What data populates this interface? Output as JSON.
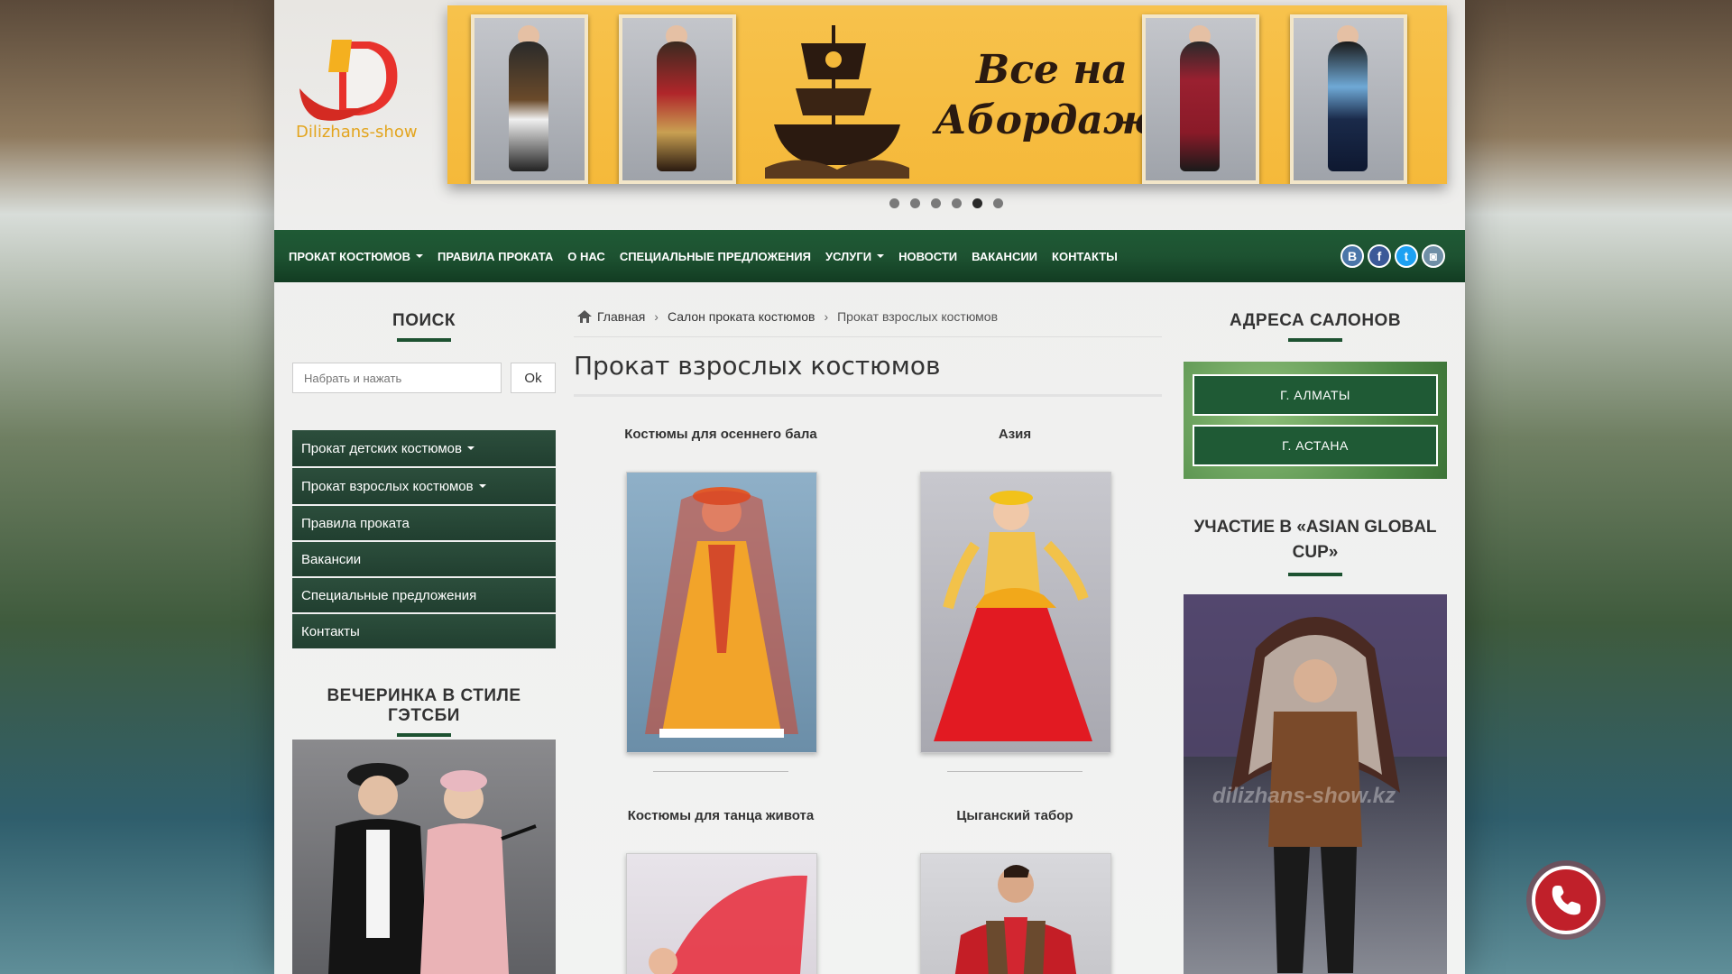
{
  "logo": {
    "text": "Dilizhans-show"
  },
  "banner": {
    "text": "Все на Абордаж!",
    "slides": 6,
    "active_slide": 5
  },
  "nav": {
    "items": [
      {
        "label": "ПРОКАТ КОСТЮМОВ",
        "dropdown": true
      },
      {
        "label": "ПРАВИЛА ПРОКАТА",
        "dropdown": false
      },
      {
        "label": "О НАС",
        "dropdown": false
      },
      {
        "label": "СПЕЦИАЛЬНЫЕ ПРЕДЛОЖЕНИЯ",
        "dropdown": false
      },
      {
        "label": "УСЛУГИ",
        "dropdown": true
      },
      {
        "label": "НОВОСТИ",
        "dropdown": false
      },
      {
        "label": "ВАКАНСИИ",
        "dropdown": false
      },
      {
        "label": "КОНТАКТЫ",
        "dropdown": false
      }
    ],
    "social": [
      {
        "label": "B",
        "icon": "vk-icon",
        "color": "#4a76a8"
      },
      {
        "label": "f",
        "icon": "facebook-icon",
        "color": "#3b5998"
      },
      {
        "label": "t",
        "icon": "twitter-icon",
        "color": "#1da1f2"
      },
      {
        "label": "◙",
        "icon": "instagram-icon",
        "color": "#6f8fa6"
      }
    ]
  },
  "search": {
    "title": "ПОИСК",
    "placeholder": "Набрать и нажать",
    "button": "Ok"
  },
  "side_menu": [
    {
      "label": "Прокат детских костюмов",
      "dropdown": true
    },
    {
      "label": "Прокат взрослых костюмов",
      "dropdown": true
    },
    {
      "label": "Правила проката",
      "dropdown": false
    },
    {
      "label": "Вакансии",
      "dropdown": false
    },
    {
      "label": "Специальные предложения",
      "dropdown": false
    },
    {
      "label": "Контакты",
      "dropdown": false
    }
  ],
  "gatsby": {
    "title": "ВЕЧЕРИНКА В СТИЛЕ ГЭТСБИ"
  },
  "breadcrumb": {
    "home": "Главная",
    "salon": "Салон проката костюмов",
    "current": "Прокат взрослых костюмов"
  },
  "page_title": "Прокат взрослых костюмов",
  "cards": [
    {
      "title": "Костюмы для осеннего бала"
    },
    {
      "title": "Азия"
    },
    {
      "title": "Костюмы для танца живота"
    },
    {
      "title": "Цыганский табор"
    }
  ],
  "addresses": {
    "title": "АДРЕСА САЛОНОВ",
    "cities": [
      "Г. АЛМАТЫ",
      "Г. АСТАНА"
    ]
  },
  "cup": {
    "title": "УЧАСТИЕ В «ASIAN GLOBAL CUP»",
    "watermark": "dilizhans-show.kz"
  },
  "colors": {
    "brand_green": "#1d5231",
    "banner_yellow": "#f5b93a",
    "call_red": "#c0202a"
  }
}
